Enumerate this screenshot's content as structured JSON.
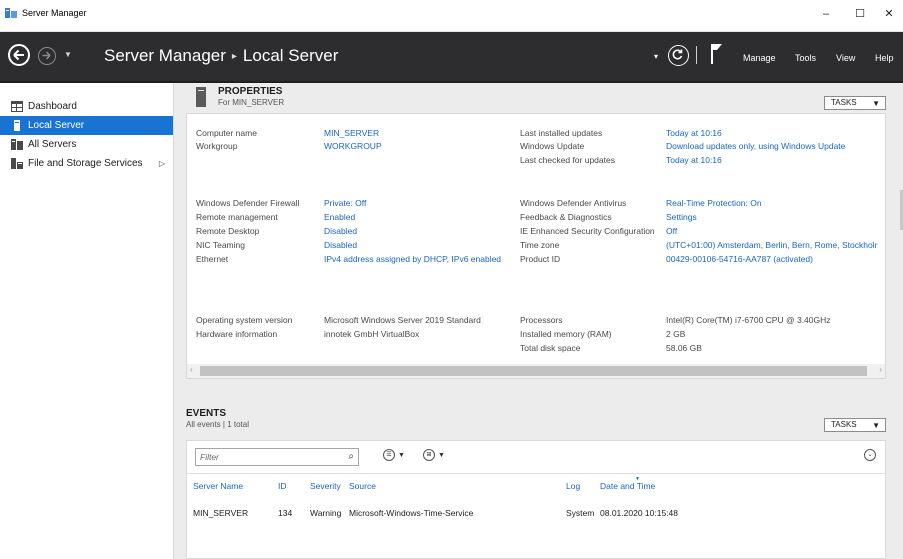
{
  "window": {
    "title": "Server Manager",
    "controls": {
      "minimize": "–",
      "maximize": "☐",
      "close": "✕"
    }
  },
  "header": {
    "app_name": "Server Manager",
    "separator": "▸",
    "page": "Local Server",
    "menu": [
      "Manage",
      "Tools",
      "View",
      "Help"
    ]
  },
  "sidebar": {
    "items": [
      {
        "label": "Dashboard",
        "icon": "dashboard-icon"
      },
      {
        "label": "Local Server",
        "icon": "server-icon",
        "active": true
      },
      {
        "label": "All Servers",
        "icon": "servers-icon"
      },
      {
        "label": "File and Storage Services",
        "icon": "storage-icon",
        "has_submenu": true
      }
    ]
  },
  "properties": {
    "title": "PROPERTIES",
    "subtitle": "For MIN_SERVER",
    "tasks_label": "TASKS",
    "left": [
      {
        "label": "Computer name",
        "value": "MIN_SERVER",
        "link": true
      },
      {
        "label": "Workgroup",
        "value": "WORKGROUP",
        "link": true
      },
      {
        "label": "Windows Defender Firewall",
        "value": "Private: Off",
        "link": true
      },
      {
        "label": "Remote management",
        "value": "Enabled",
        "link": true
      },
      {
        "label": "Remote Desktop",
        "value": "Disabled",
        "link": true
      },
      {
        "label": "NIC Teaming",
        "value": "Disabled",
        "link": true
      },
      {
        "label": "Ethernet",
        "value": "IPv4 address assigned by DHCP, IPv6 enabled",
        "link": true
      },
      {
        "label": "Operating system version",
        "value": "Microsoft Windows Server 2019 Standard",
        "link": false
      },
      {
        "label": "Hardware information",
        "value": "innotek GmbH VirtualBox",
        "link": false
      }
    ],
    "right": [
      {
        "label": "Last installed updates",
        "value": "Today at 10:16",
        "link": true
      },
      {
        "label": "Windows Update",
        "value": "Download updates only, using Windows Update",
        "link": true
      },
      {
        "label": "Last checked for updates",
        "value": "Today at 10:16",
        "link": true
      },
      {
        "label": "Windows Defender Antivirus",
        "value": "Real-Time Protection: On",
        "link": true
      },
      {
        "label": "Feedback & Diagnostics",
        "value": "Settings",
        "link": true
      },
      {
        "label": "IE Enhanced Security Configuration",
        "value": "Off",
        "link": true
      },
      {
        "label": "Time zone",
        "value": "(UTC+01:00) Amsterdam, Berlin, Bern, Rome, Stockholr",
        "link": true
      },
      {
        "label": "Product ID",
        "value": "00429-00106-54716-AA787 (activated)",
        "link": true
      },
      {
        "label": "Processors",
        "value": "Intel(R) Core(TM) i7-6700 CPU @ 3.40GHz",
        "link": false
      },
      {
        "label": "Installed memory (RAM)",
        "value": "2 GB",
        "link": false
      },
      {
        "label": "Total disk space",
        "value": "58.06 GB",
        "link": false
      }
    ]
  },
  "events": {
    "title": "EVENTS",
    "subtitle": "All events | 1 total",
    "tasks_label": "TASKS",
    "filter_placeholder": "Filter",
    "columns": [
      "Server Name",
      "ID",
      "Severity",
      "Source",
      "Log",
      "Date and Time"
    ],
    "rows": [
      {
        "server": "MIN_SERVER",
        "id": "134",
        "severity": "Warning",
        "source": "Microsoft-Windows-Time-Service",
        "log": "System",
        "datetime": "08.01.2020 10:15:48"
      }
    ]
  },
  "colors": {
    "header_bg": "#2d2d30",
    "active_item": "#1873d3",
    "link": "#1a66c2",
    "panel_bg": "#ececec"
  }
}
